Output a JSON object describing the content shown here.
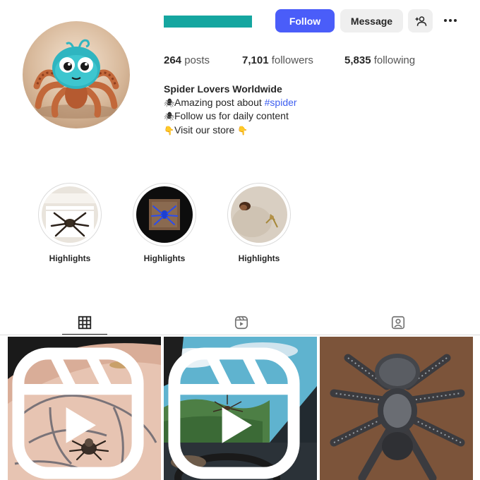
{
  "profile": {
    "follow_label": "Follow",
    "message_label": "Message",
    "suggest_icon": "person-plus-icon",
    "more_icon": "more-horizontal-icon"
  },
  "stats": {
    "posts_count": "264",
    "posts_label": "posts",
    "followers_count": "7,101",
    "followers_label": "followers",
    "following_count": "5,835",
    "following_label": "following"
  },
  "bio": {
    "name": "Spider Lovers Worldwide",
    "line1_prefix": "Amazing post about ",
    "line1_hashtag": "#spider",
    "line2": "Follow us for daily content",
    "line3": "Visit our store "
  },
  "highlights": [
    {
      "label": "Highlights"
    },
    {
      "label": "Highlights"
    },
    {
      "label": "Highlights"
    }
  ],
  "tabs": [
    {
      "icon": "grid-icon",
      "active": true
    },
    {
      "icon": "reels-icon",
      "active": false
    },
    {
      "icon": "tagged-icon",
      "active": false
    }
  ],
  "colors": {
    "accent": "#4a5df9",
    "username_redaction": "#15a6a0",
    "hashtag": "#3d5ef0"
  }
}
